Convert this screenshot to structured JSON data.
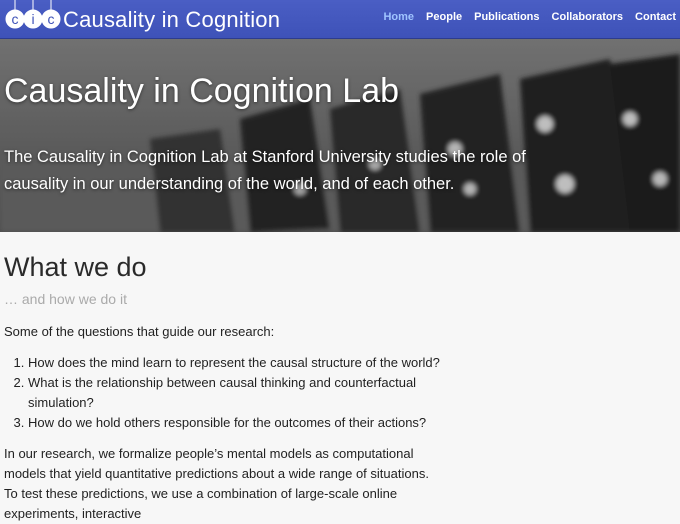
{
  "nav": {
    "logo_letters": [
      "c",
      "i",
      "c"
    ],
    "brand": "Causality in Cognition",
    "items": [
      {
        "label": "Home",
        "active": true
      },
      {
        "label": "People",
        "active": false
      },
      {
        "label": "Publications",
        "active": false
      },
      {
        "label": "Collaborators",
        "active": false
      },
      {
        "label": "Contact",
        "active": false
      }
    ]
  },
  "hero": {
    "title": "Causality in Cognition Lab",
    "text": "The Causality in Cognition Lab at Stanford University studies the role of causality in our understanding of the world, and of each other."
  },
  "main": {
    "title": "What we do",
    "subtitle": "… and how we do it",
    "intro": "Some of the questions that guide our research:",
    "questions": [
      "How does the mind learn to represent the causal structure of the world?",
      "What is the relationship between causal thinking and counterfactual simulation?",
      "How do we hold others responsible for the outcomes of their actions?"
    ],
    "paragraph": "In our research, we formalize people’s mental models as computational models that yield quantitative predictions about a wide range of situations. To test these predictions, we use a combination of large-scale online experiments, interactive"
  },
  "colors": {
    "navbar": "#4358c0",
    "active_nav": "#9fc4ff",
    "page_background": "#f7f7f7"
  }
}
